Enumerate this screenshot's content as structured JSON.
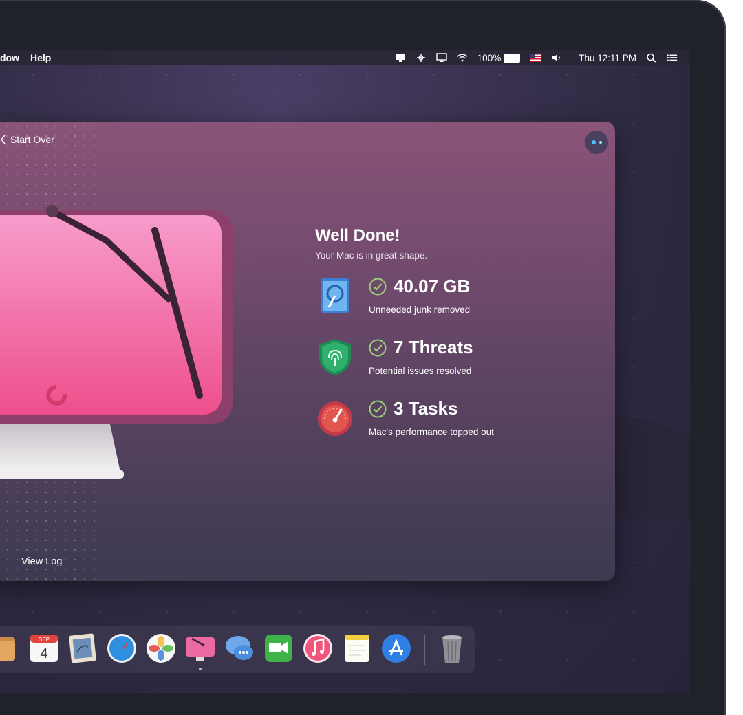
{
  "menubar": {
    "left_items": [
      "dow",
      "Help"
    ],
    "battery": "100%",
    "clock": "Thu 12:11 PM"
  },
  "window": {
    "back_label": "Start Over",
    "title": "Well Done!",
    "subtitle": "Your Mac is in great shape.",
    "stats": [
      {
        "value": "40.07 GB",
        "label": "Unneeded junk removed",
        "icon": "disk-cleanup-icon"
      },
      {
        "value": "7 Threats",
        "label": "Potential issues resolved",
        "icon": "fingerprint-shield-icon"
      },
      {
        "value": "3 Tasks",
        "label": "Mac's performance topped out",
        "icon": "speedometer-icon"
      }
    ],
    "view_log": "View Log"
  },
  "dock": {
    "calendar_month": "SEP",
    "calendar_day": "4",
    "apps": [
      "folder-icon",
      "calendar-icon",
      "mail-icon",
      "safari-icon",
      "photos-icon",
      "cleanmymac-icon",
      "messages-icon",
      "facetime-icon",
      "music-icon",
      "notes-icon",
      "app-store-icon",
      "trash-icon"
    ]
  },
  "colors": {
    "accent_check": "#9ad27a",
    "assistant_dot": "#4fc3f7"
  }
}
